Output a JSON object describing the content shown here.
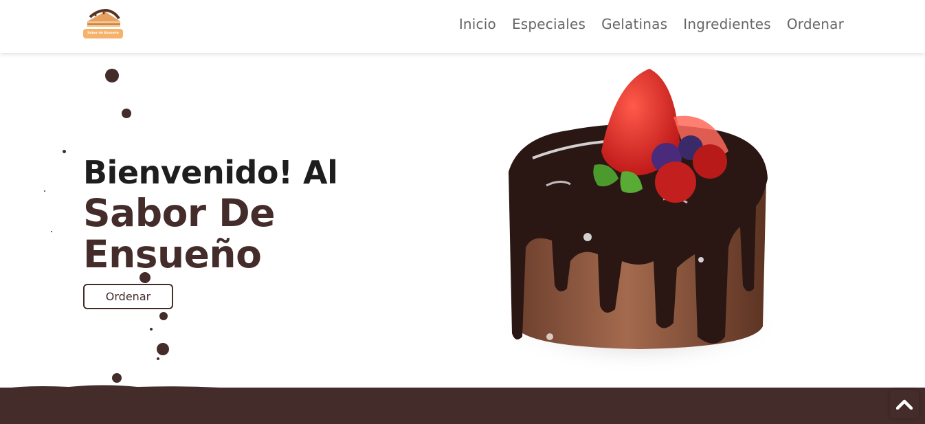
{
  "nav": {
    "logo_text": "Sabor de Ensueño",
    "links": [
      "Inicio",
      "Especiales",
      "Gelatinas",
      "Ingredientes",
      "Ordenar"
    ]
  },
  "hero": {
    "line1": "Bienvenido! Al",
    "line2": "Sabor De",
    "line3": "Ensueño",
    "button_label": "Ordenar"
  },
  "colors": {
    "brand": "#442c2a",
    "nav_text": "#666666",
    "logo_badge": "#f6b26b"
  },
  "icons": {
    "logo": "cake-slice-logo-icon",
    "scroll_top": "chevron-up-icon"
  }
}
